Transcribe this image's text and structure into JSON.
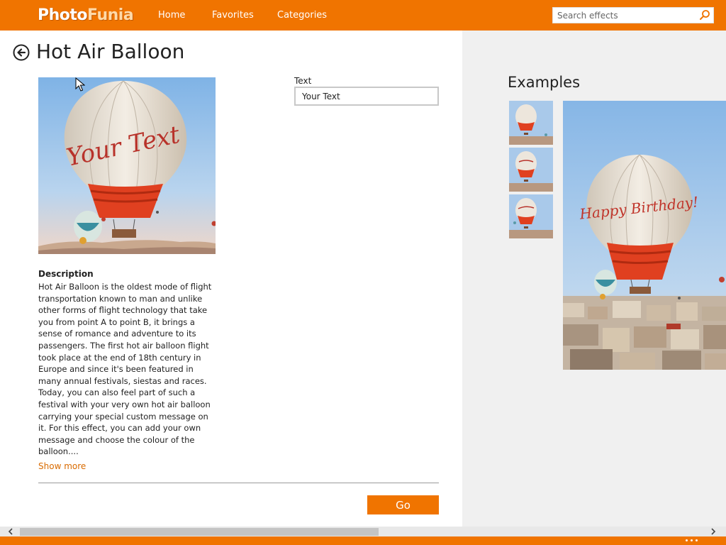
{
  "app": {
    "logo_part1": "Photo",
    "logo_part2": "Funia",
    "nav": {
      "home": "Home",
      "favorites": "Favorites",
      "categories": "Categories"
    },
    "search": {
      "placeholder": "Search effects",
      "icon": "search-icon"
    },
    "colors": {
      "accent": "#f07400",
      "link": "#d96b00",
      "panel_bg": "#f0f0f0"
    }
  },
  "effect": {
    "title": "Hot Air Balloon",
    "preview_text": "Your Text",
    "field": {
      "label": "Text",
      "value": "Your Text"
    },
    "description_title": "Description",
    "description": "Hot Air Balloon is the oldest mode of flight transportation known to man and unlike other forms of flight technology that take you from point A to point B, it brings a sense of romance and adventure to its passengers. The first hot air balloon flight took place at the end of 18th century in Europe and since it's been featured in many annual festivals, siestas and races. Today, you can also feel part of such a festival with your very own hot air balloon carrying your special custom message on it. For this effect, you can add your own message and choose the colour of the balloon....",
    "show_more": "Show more",
    "go_label": "Go"
  },
  "examples": {
    "title": "Examples",
    "large_text": "Happy Birthday!"
  }
}
